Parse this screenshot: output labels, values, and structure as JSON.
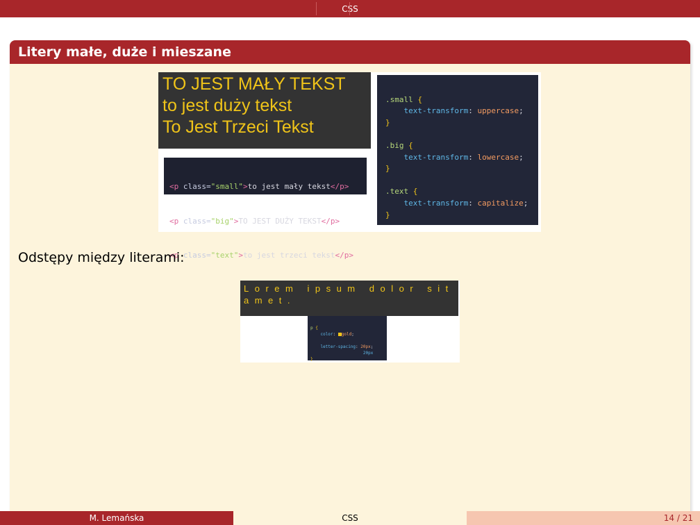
{
  "header": {
    "section": "CSS"
  },
  "block": {
    "title": "Litery małe, duże i mieszane"
  },
  "demo1": {
    "output_lines": [
      "TO JEST MAŁY TEKST",
      "to jest duży tekst",
      "To Jest Trzeci Tekst"
    ],
    "html_lines": [
      {
        "cls": "small",
        "text": "to jest mały tekst"
      },
      {
        "cls": "big",
        "text": "TO JEST DUŻY TEKST"
      },
      {
        "cls": "text",
        "text": "to jest trzeci tekst"
      }
    ],
    "css_rules": [
      {
        "selector": ".small",
        "property": "text-transform",
        "value": "uppercase"
      },
      {
        "selector": ".big",
        "property": "text-transform",
        "value": "lowercase"
      },
      {
        "selector": ".text",
        "property": "text-transform",
        "value": "capitalize"
      }
    ]
  },
  "spacing_label": "Odstępy między literami:",
  "demo2": {
    "output_text": "Lorem ipsum dolor sit amet.",
    "selector": "p",
    "color_prop": "color",
    "color_val": "gold",
    "ls_prop": "letter-spacing",
    "ls_val": "20px",
    "hint": "20px"
  },
  "footer": {
    "author": "M. Lemańska",
    "title": "CSS",
    "page": "14 / 21"
  },
  "colors": {
    "accent": "#a8262a",
    "block_bg": "#fdf4dc",
    "code_bg": "#222638",
    "gold": "#f0c419"
  }
}
